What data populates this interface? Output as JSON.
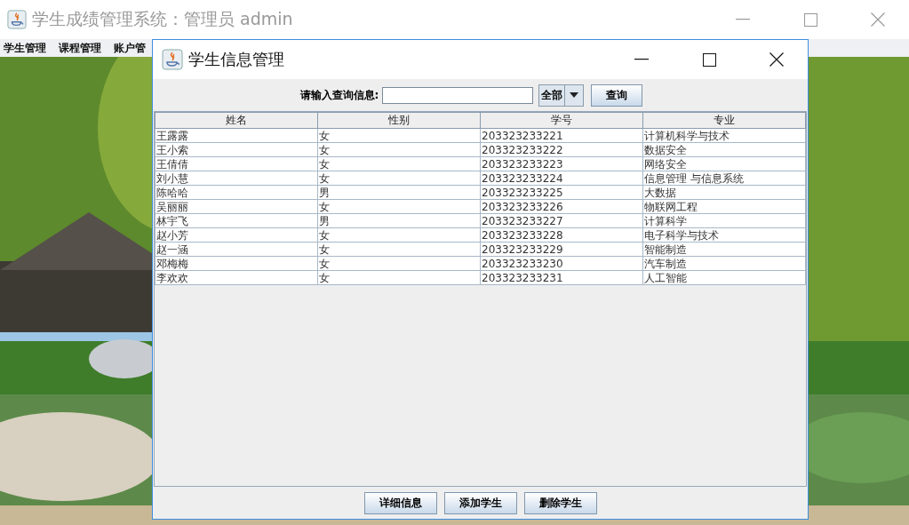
{
  "window": {
    "title": "学生成绩管理系统：管理员 admin"
  },
  "menu": [
    "学生管理",
    "课程管理",
    "账户管"
  ],
  "background": {
    "kind": "picture"
  },
  "dialog": {
    "title": "学生信息管理",
    "search": {
      "label": "请输入查询信息:",
      "combo": "全部",
      "button": "查询"
    },
    "table": {
      "columns": [
        "姓名",
        "性别",
        "学号",
        "专业"
      ],
      "rows": [
        [
          "王露露",
          "女",
          "203323233221",
          "计算机科学与技术"
        ],
        [
          "王小索",
          "女",
          "203323233222",
          "数据安全"
        ],
        [
          "王倩倩",
          "女",
          "203323233223",
          "网络安全"
        ],
        [
          "刘小慧",
          "女",
          "203323233224",
          "信息管理 与信息系统"
        ],
        [
          "陈哈哈",
          "男",
          "203323233225",
          "大数据"
        ],
        [
          "吴丽丽",
          "女",
          "203323233226",
          "物联网工程"
        ],
        [
          "林宇飞",
          "男",
          "203323233227",
          "计算科学"
        ],
        [
          "赵小芳",
          "女",
          "203323233228",
          "电子科学与技术"
        ],
        [
          "赵一涵",
          "女",
          "203323233229",
          "智能制造"
        ],
        [
          "邓梅梅",
          "女",
          "203323233230",
          "汽车制造"
        ],
        [
          "李欢欢",
          "女",
          "203323233231",
          "人工智能"
        ]
      ]
    },
    "buttons": [
      "详细信息",
      "添加学生",
      "删除学生"
    ]
  }
}
